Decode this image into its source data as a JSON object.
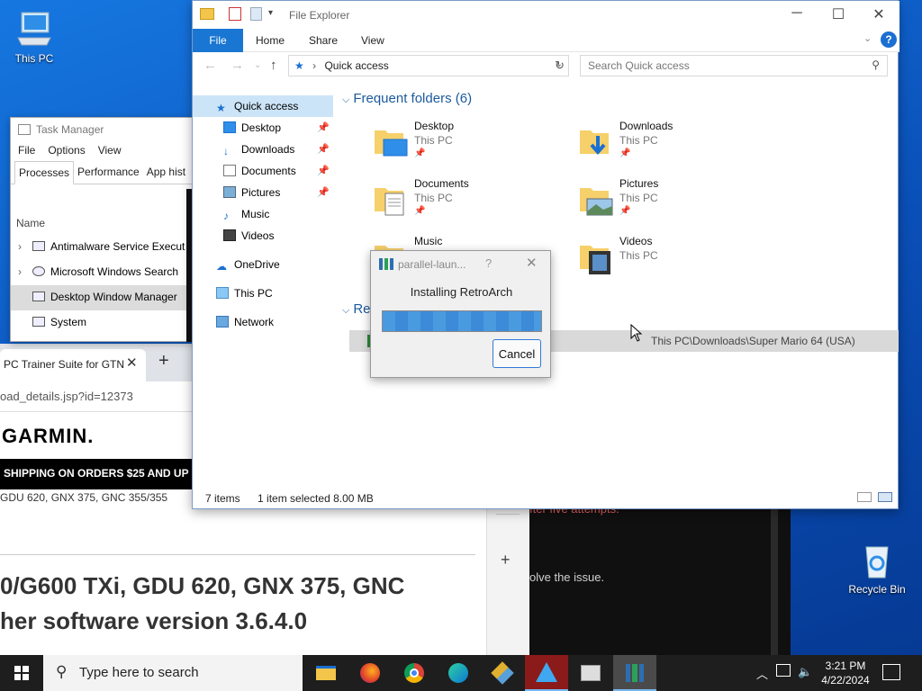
{
  "desktop": {
    "icons": [
      {
        "label": "This PC"
      },
      {
        "label": "Recycle Bin"
      }
    ]
  },
  "browser": {
    "tab_title": "PC Trainer Suite for GTN",
    "address": "oad_details.jsp?id=12373",
    "brand": "GARMIN.",
    "promo": "SHIPPING ON ORDERS $25 AND UP",
    "models_line": "GDU 620, GNX 375, GNC 355/355",
    "heading_line1": "0/G600 TXi, GDU 620, GNX 375, GNC",
    "heading_line2": "her software version 3.6.4.0"
  },
  "terminal": {
    "line1": "fter five attempts.",
    "line2": "olve the issue."
  },
  "task_manager": {
    "title": "Task Manager",
    "menu": [
      "File",
      "Options",
      "View"
    ],
    "tabs": [
      "Processes",
      "Performance",
      "App hist"
    ],
    "column_name": "Name",
    "rows": [
      {
        "name": "Antimalware Service Execut",
        "expandable": true
      },
      {
        "name": "Microsoft Windows Search",
        "expandable": true
      },
      {
        "name": "Desktop Window Manager",
        "expandable": false
      },
      {
        "name": "System",
        "expandable": false
      }
    ]
  },
  "explorer": {
    "title": "File Explorer",
    "ribbon_tabs": [
      "File",
      "Home",
      "Share",
      "View"
    ],
    "address": "Quick access",
    "search_placeholder": "Search Quick access",
    "nav": [
      {
        "label": "Quick access",
        "icon": "star-icon",
        "pinned": false
      },
      {
        "label": "Desktop",
        "icon": "desktop-icon",
        "pinned": true
      },
      {
        "label": "Downloads",
        "icon": "download-icon",
        "pinned": true
      },
      {
        "label": "Documents",
        "icon": "documents-icon",
        "pinned": true
      },
      {
        "label": "Pictures",
        "icon": "pictures-icon",
        "pinned": true
      },
      {
        "label": "Music",
        "icon": "music-icon",
        "pinned": false
      },
      {
        "label": "Videos",
        "icon": "videos-icon",
        "pinned": false
      },
      {
        "label": "OneDrive",
        "icon": "cloud-icon",
        "pinned": false
      },
      {
        "label": "This PC",
        "icon": "computer-icon",
        "pinned": false
      },
      {
        "label": "Network",
        "icon": "network-icon",
        "pinned": false
      }
    ],
    "frequent_header": "Frequent folders (6)",
    "folders": [
      {
        "name": "Desktop",
        "location": "This PC",
        "pinned": true
      },
      {
        "name": "Downloads",
        "location": "This PC",
        "pinned": true
      },
      {
        "name": "Documents",
        "location": "This PC",
        "pinned": true
      },
      {
        "name": "Pictures",
        "location": "This PC",
        "pinned": true
      },
      {
        "name": "Music",
        "location": "",
        "pinned": false
      },
      {
        "name": "Videos",
        "location": "This PC",
        "pinned": false
      }
    ],
    "recent_header": "Re",
    "recent_item_path": "This PC\\Downloads\\Super Mario 64 (USA)",
    "status_items": "7 items",
    "status_selected": "1 item selected  8.00 MB"
  },
  "dialog": {
    "title": "parallel-laun...",
    "help": "?",
    "message": "Installing RetroArch",
    "progress": 1.0,
    "cancel_label": "Cancel"
  },
  "taskbar": {
    "search_placeholder": "Type here to search",
    "apps": [
      "file-explorer-icon",
      "firefox-icon",
      "chrome-icon",
      "edge-icon",
      "git-icon",
      "app-a-icon",
      "photos-icon",
      "parallel-launcher-icon"
    ],
    "time": "3:21 PM",
    "date": "4/22/2024"
  },
  "colors": {
    "accent": "#1976d2",
    "desktop": "#0a4fb8",
    "taskbar": "#1e1e1e",
    "selection": "#cce4f7"
  }
}
